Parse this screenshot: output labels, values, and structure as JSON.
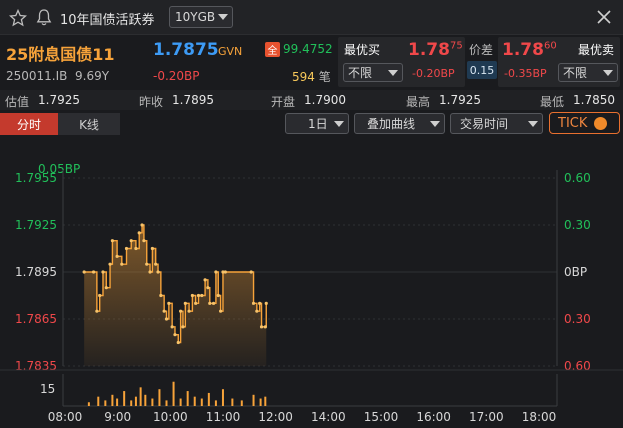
{
  "window": {
    "title": "10年国债活跃券",
    "term_select": "10YGB"
  },
  "quote": {
    "name": "25附息国债11",
    "price": "1.7875",
    "price_src": "GVN",
    "full_badge": "全",
    "full_price": "99.4752",
    "code": "250011.IB",
    "maturity": "9.69Y",
    "change": "-0.20BP",
    "volume": "594",
    "volume_unit": "笔"
  },
  "bid": {
    "label": "最优买",
    "price": "1.78",
    "price_sup": "75",
    "select": "不限",
    "change": "-0.20BP"
  },
  "spread": {
    "label": "价差",
    "value": "0.15"
  },
  "ask": {
    "label": "最优卖",
    "price": "1.78",
    "price_sup": "60",
    "select": "不限",
    "change": "-0.35BP"
  },
  "stats": [
    {
      "label": "估值",
      "value": "1.7925"
    },
    {
      "label": "昨收",
      "value": "1.7895"
    },
    {
      "label": "开盘",
      "value": "1.7900"
    },
    {
      "label": "最高",
      "value": "1.7925"
    },
    {
      "label": "最低",
      "value": "1.7850"
    }
  ],
  "toolbar": {
    "tab_intraday": "分时",
    "tab_kline": "K线",
    "period": "1日",
    "overlay": "叠加曲线",
    "trade_time": "交易时间",
    "tick": "TICK"
  },
  "colors": {
    "up": "#f0484a",
    "down": "#21c05a",
    "line": "#f7a33a",
    "accent": "#3d9bf5"
  },
  "chart_data": {
    "type": "line",
    "top_label": "0.05BP",
    "y_left_ticks": [
      "1.7955",
      "1.7925",
      "1.7895",
      "1.7865",
      "1.7835"
    ],
    "y_right_ticks": [
      "0.60",
      "0.30",
      "0BP",
      "0.30",
      "0.60"
    ],
    "x_ticks": [
      "08:00",
      "9:00",
      "10:00",
      "11:00",
      "12:00",
      "14:00",
      "15:00",
      "16:00",
      "17:00",
      "18:00"
    ],
    "volume_tick": "15",
    "ylim": [
      1.7835,
      1.7955
    ],
    "series": [
      {
        "points": [
          [
            8.45,
            1.7895
          ],
          [
            8.65,
            1.7895
          ],
          [
            8.72,
            1.787
          ],
          [
            8.78,
            1.788
          ],
          [
            8.85,
            1.7895
          ],
          [
            8.92,
            1.7885
          ],
          [
            9.0,
            1.79
          ],
          [
            9.05,
            1.7915
          ],
          [
            9.15,
            1.7905
          ],
          [
            9.25,
            1.79
          ],
          [
            9.35,
            1.791
          ],
          [
            9.45,
            1.7915
          ],
          [
            9.55,
            1.791
          ],
          [
            9.62,
            1.792
          ],
          [
            9.68,
            1.7925
          ],
          [
            9.72,
            1.7915
          ],
          [
            9.78,
            1.79
          ],
          [
            9.85,
            1.7895
          ],
          [
            9.9,
            1.791
          ],
          [
            9.97,
            1.79
          ],
          [
            10.02,
            1.7895
          ],
          [
            10.08,
            1.788
          ],
          [
            10.15,
            1.787
          ],
          [
            10.2,
            1.7865
          ],
          [
            10.25,
            1.7875
          ],
          [
            10.32,
            1.786
          ],
          [
            10.38,
            1.7855
          ],
          [
            10.45,
            1.785
          ],
          [
            10.5,
            1.787
          ],
          [
            10.55,
            1.786
          ],
          [
            10.6,
            1.7875
          ],
          [
            10.68,
            1.787
          ],
          [
            10.75,
            1.788
          ],
          [
            10.82,
            1.7875
          ],
          [
            10.88,
            1.788
          ],
          [
            10.95,
            1.788
          ],
          [
            11.02,
            1.789
          ],
          [
            11.08,
            1.7885
          ],
          [
            11.12,
            1.7875
          ],
          [
            11.2,
            1.7875
          ],
          [
            11.25,
            1.7895
          ],
          [
            11.3,
            1.788
          ],
          [
            11.35,
            1.787
          ],
          [
            11.4,
            1.7895
          ],
          [
            11.45,
            1.7895
          ],
          [
            12.0,
            1.7895
          ],
          [
            12.05,
            1.7875
          ],
          [
            12.12,
            1.787
          ],
          [
            12.18,
            1.7875
          ],
          [
            12.22,
            1.786
          ],
          [
            12.3,
            1.786
          ],
          [
            12.32,
            1.7875
          ]
        ]
      }
    ],
    "volume": [
      [
        8.55,
        2
      ],
      [
        8.75,
        5
      ],
      [
        8.9,
        3
      ],
      [
        9.05,
        6
      ],
      [
        9.15,
        4
      ],
      [
        9.3,
        8
      ],
      [
        9.45,
        3
      ],
      [
        9.55,
        5
      ],
      [
        9.65,
        10
      ],
      [
        9.75,
        6
      ],
      [
        9.9,
        4
      ],
      [
        10.05,
        9
      ],
      [
        10.2,
        3
      ],
      [
        10.35,
        13
      ],
      [
        10.5,
        4
      ],
      [
        10.65,
        8
      ],
      [
        10.8,
        5
      ],
      [
        10.95,
        4
      ],
      [
        11.1,
        7
      ],
      [
        11.25,
        3
      ],
      [
        11.4,
        9
      ],
      [
        11.6,
        4
      ],
      [
        11.8,
        3
      ],
      [
        12.05,
        6
      ],
      [
        12.2,
        4
      ],
      [
        12.3,
        5
      ]
    ]
  }
}
